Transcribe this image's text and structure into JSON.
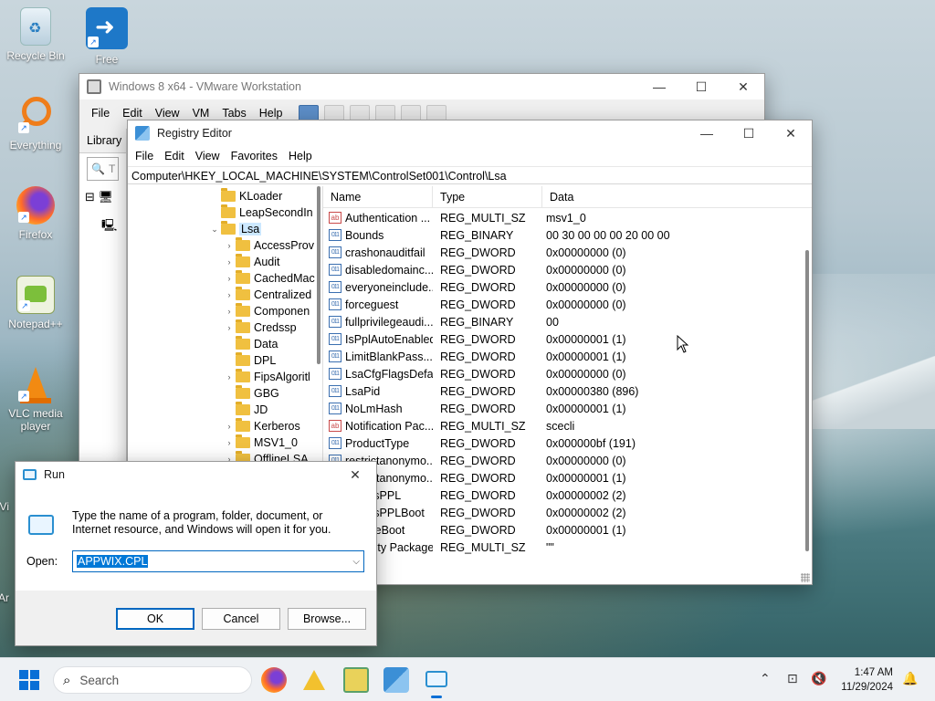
{
  "desktop": {
    "icons": [
      {
        "label": "Recycle Bin"
      },
      {
        "label": "Free"
      },
      {
        "label": "Everything"
      },
      {
        "label": "Firefox"
      },
      {
        "label": "Notepad++"
      },
      {
        "label": "VLC media player"
      }
    ],
    "edge_labels": [
      "Vi",
      "Ar"
    ]
  },
  "vmware": {
    "title": "Windows 8 x64 - VMware Workstation",
    "menu": [
      "File",
      "Edit",
      "View",
      "VM",
      "Tabs",
      "Help"
    ],
    "library_title": "Library",
    "library_search_placeholder": "T"
  },
  "regedit": {
    "title": "Registry Editor",
    "menu": [
      "File",
      "Edit",
      "View",
      "Favorites",
      "Help"
    ],
    "address": "Computer\\HKEY_LOCAL_MACHINE\\SYSTEM\\ControlSet001\\Control\\Lsa",
    "tree": [
      {
        "label": "KLoader",
        "arrow": ""
      },
      {
        "label": "LeapSecondIn",
        "arrow": ""
      },
      {
        "label": "Lsa",
        "arrow": "⌄",
        "selected": true
      },
      {
        "label": "AccessProv",
        "arrow": "›"
      },
      {
        "label": "Audit",
        "arrow": "›"
      },
      {
        "label": "CachedMac",
        "arrow": "›"
      },
      {
        "label": "Centralized",
        "arrow": "›"
      },
      {
        "label": "Componen",
        "arrow": "›"
      },
      {
        "label": "Credssp",
        "arrow": "›"
      },
      {
        "label": "Data",
        "arrow": ""
      },
      {
        "label": "DPL",
        "arrow": ""
      },
      {
        "label": "FipsAlgoritl",
        "arrow": "›"
      },
      {
        "label": "GBG",
        "arrow": ""
      },
      {
        "label": "JD",
        "arrow": ""
      },
      {
        "label": "Kerberos",
        "arrow": "›"
      },
      {
        "label": "MSV1_0",
        "arrow": "›"
      },
      {
        "label": "OfflineLSA",
        "arrow": "›"
      }
    ],
    "columns": [
      "Name",
      "Type",
      "Data"
    ],
    "rows": [
      {
        "name": "Authentication ...",
        "type": "REG_MULTI_SZ",
        "data": "msv1_0",
        "icon": "sz"
      },
      {
        "name": "Bounds",
        "type": "REG_BINARY",
        "data": "00 30 00 00 00 20 00 00",
        "icon": "bin"
      },
      {
        "name": "crashonauditfail",
        "type": "REG_DWORD",
        "data": "0x00000000 (0)",
        "icon": "bin"
      },
      {
        "name": "disabledomainc...",
        "type": "REG_DWORD",
        "data": "0x00000000 (0)",
        "icon": "bin"
      },
      {
        "name": "everyoneinclude...",
        "type": "REG_DWORD",
        "data": "0x00000000 (0)",
        "icon": "bin"
      },
      {
        "name": "forceguest",
        "type": "REG_DWORD",
        "data": "0x00000000 (0)",
        "icon": "bin"
      },
      {
        "name": "fullprivilegeaudi...",
        "type": "REG_BINARY",
        "data": "00",
        "icon": "bin"
      },
      {
        "name": "IsPplAutoEnabled",
        "type": "REG_DWORD",
        "data": "0x00000001 (1)",
        "icon": "bin"
      },
      {
        "name": "LimitBlankPass...",
        "type": "REG_DWORD",
        "data": "0x00000001 (1)",
        "icon": "bin"
      },
      {
        "name": "LsaCfgFlagsDefa...",
        "type": "REG_DWORD",
        "data": "0x00000000 (0)",
        "icon": "bin"
      },
      {
        "name": "LsaPid",
        "type": "REG_DWORD",
        "data": "0x00000380 (896)",
        "icon": "bin"
      },
      {
        "name": "NoLmHash",
        "type": "REG_DWORD",
        "data": "0x00000001 (1)",
        "icon": "bin"
      },
      {
        "name": "Notification Pac...",
        "type": "REG_MULTI_SZ",
        "data": "scecli",
        "icon": "sz"
      },
      {
        "name": "ProductType",
        "type": "REG_DWORD",
        "data": "0x000000bf (191)",
        "icon": "bin"
      },
      {
        "name": "restrictanonymo...",
        "type": "REG_DWORD",
        "data": "0x00000000 (0)",
        "icon": "bin"
      },
      {
        "name": "restrictanonymo...",
        "type": "REG_DWORD",
        "data": "0x00000001 (1)",
        "icon": "bin"
      },
      {
        "name": "RunAsPPL",
        "type": "REG_DWORD",
        "data": "0x00000002 (2)",
        "icon": "bin"
      },
      {
        "name": "RunAsPPLBoot",
        "type": "REG_DWORD",
        "data": "0x00000002 (2)",
        "icon": "bin"
      },
      {
        "name": "SecureBoot",
        "type": "REG_DWORD",
        "data": "0x00000001 (1)",
        "icon": "bin"
      },
      {
        "name": "Security Packages",
        "type": "REG_MULTI_SZ",
        "data": "\"\"",
        "icon": "sz"
      }
    ]
  },
  "run": {
    "title": "Run",
    "message": "Type the name of a program, folder, document, or Internet resource, and Windows will open it for you.",
    "open_label": "Open:",
    "value": "APPWIX.CPL",
    "ok": "OK",
    "cancel": "Cancel",
    "browse": "Browse..."
  },
  "taskbar": {
    "search_label": "Search",
    "time": "1:47 AM",
    "date": "11/29/2024"
  },
  "colors": {
    "accent": "#0067c0",
    "selection": "#0078d7"
  }
}
